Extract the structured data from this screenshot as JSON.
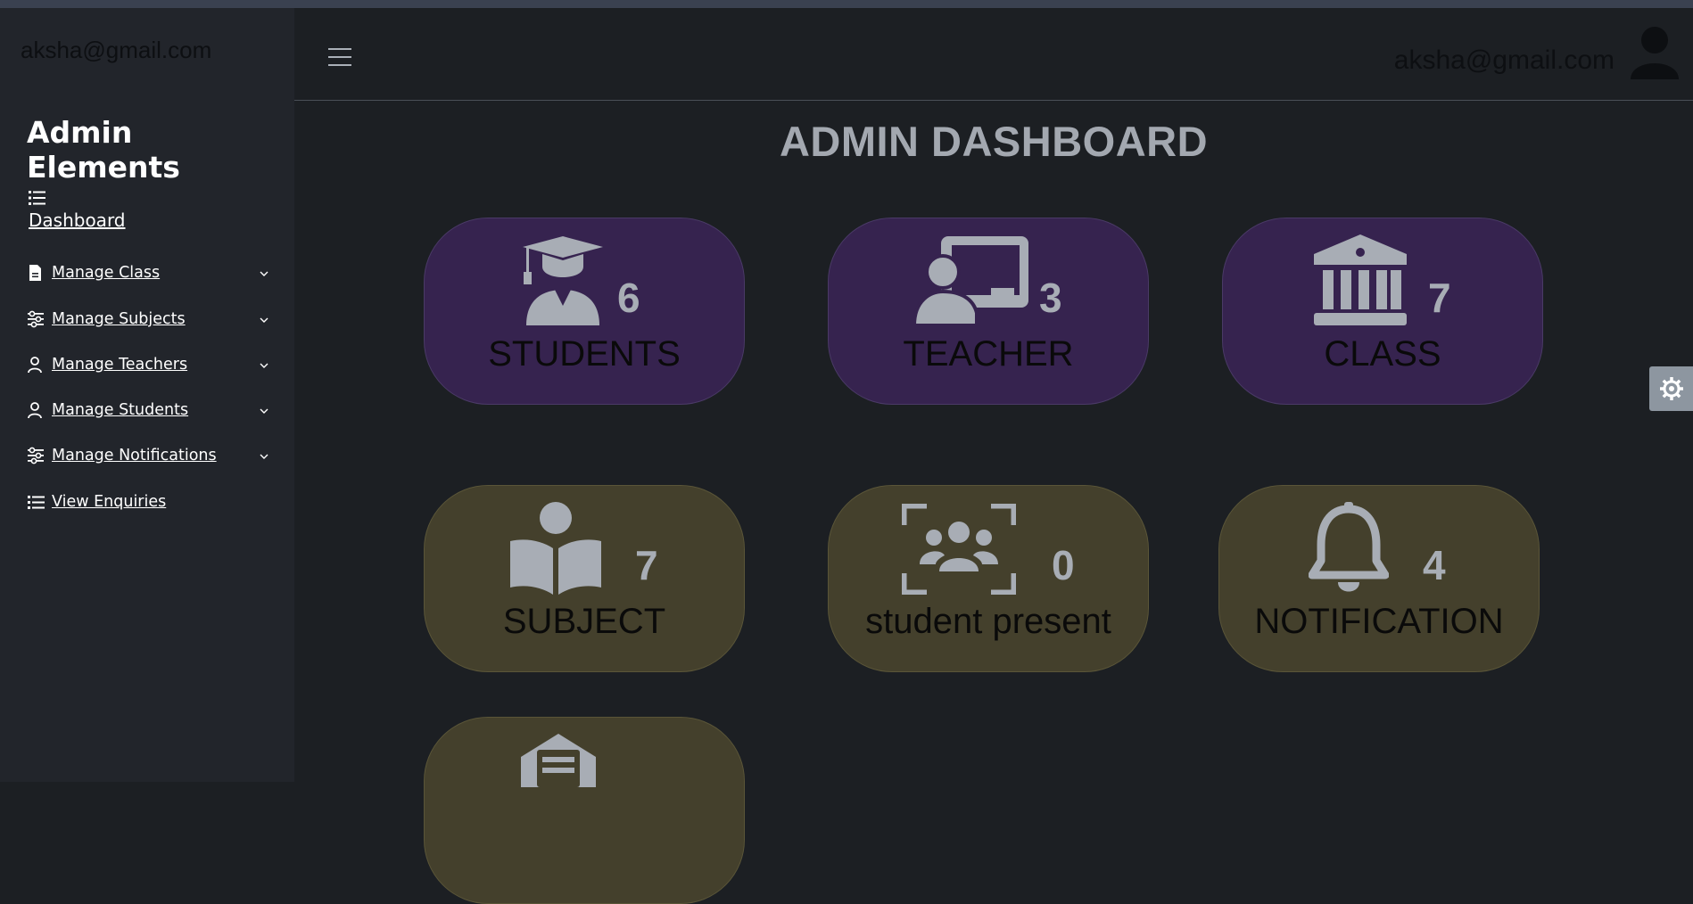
{
  "sidebar": {
    "email": "aksha@gmail.com",
    "brand": "Admin Elements",
    "dashboard_label": "Dashboard",
    "items": [
      {
        "label": "Manage Class",
        "icon": "file-icon"
      },
      {
        "label": "Manage Subjects",
        "icon": "sliders-icon"
      },
      {
        "label": "Manage Teachers",
        "icon": "user-icon"
      },
      {
        "label": "Manage Students",
        "icon": "user-icon"
      },
      {
        "label": "Manage Notifications",
        "icon": "sliders-icon"
      },
      {
        "label": "View Enquiries",
        "icon": "list-icon"
      }
    ]
  },
  "topbar": {
    "email": "aksha@gmail.com"
  },
  "page_title": "ADMIN DASHBOARD",
  "cards": [
    {
      "label": "STUDENTS",
      "count": "6",
      "icon": "graduate-icon",
      "color": "#36234f"
    },
    {
      "label": "TEACHER",
      "count": "3",
      "icon": "teacher-board-icon",
      "color": "#36234f"
    },
    {
      "label": "CLASS",
      "count": "7",
      "icon": "institution-icon",
      "color": "#36234f"
    },
    {
      "label": "SUBJECT",
      "count": "7",
      "icon": "book-reader-icon",
      "color": "#44402c"
    },
    {
      "label": "student present",
      "count": "0",
      "icon": "group-scan-icon",
      "color": "#44402c"
    },
    {
      "label": "NOTIFICATION",
      "count": "4",
      "icon": "bell-icon",
      "color": "#44402c"
    },
    {
      "label": "",
      "count": "",
      "icon": "envelope-icon",
      "color": "#44402c"
    }
  ],
  "colors": {
    "sidebar_bg": "#22252b",
    "main_bg": "#1c1f23",
    "purple_card": "#36234f",
    "olive_card": "#44402c",
    "icon_gray": "#a8adb5"
  }
}
